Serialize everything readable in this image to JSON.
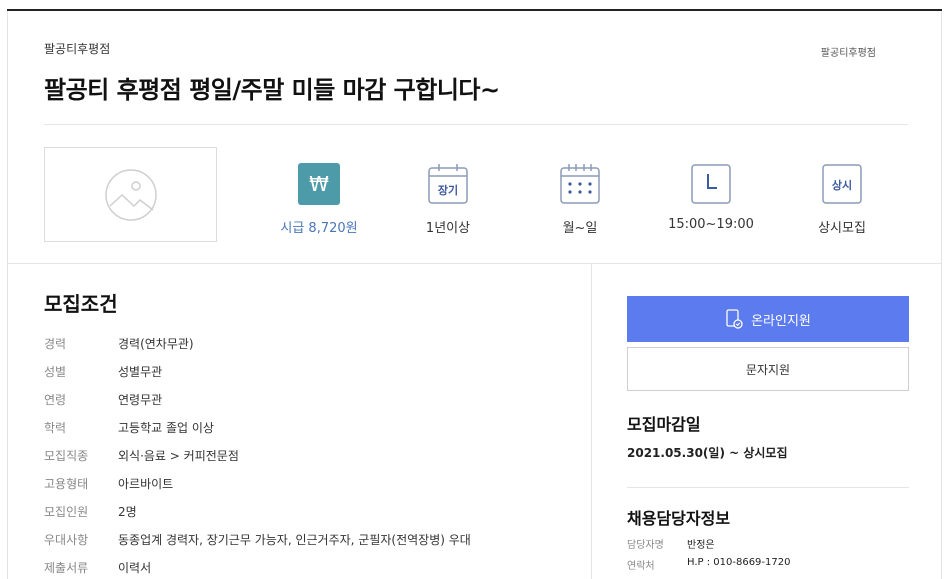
{
  "header": {
    "company": "팔공티후평점",
    "company_right": "팔공티후평점",
    "title": "팔공티 후평점 평일/주말 미들 마감 구합니다~"
  },
  "summary": [
    {
      "label": "시급 8,720원",
      "icon": "won-icon",
      "badge": "₩"
    },
    {
      "label": "1년이상",
      "icon": "calendar-long-term-icon",
      "badge": "장기"
    },
    {
      "label": "월~일",
      "icon": "calendar-days-icon"
    },
    {
      "label": "15:00~19:00",
      "icon": "clock-icon"
    },
    {
      "label": "상시모집",
      "icon": "always-recruit-icon",
      "badge": "상시"
    }
  ],
  "conditions": {
    "title": "모집조건",
    "rows": [
      {
        "key": "경력",
        "value": "경력(연차무관)"
      },
      {
        "key": "성별",
        "value": "성별무관"
      },
      {
        "key": "연령",
        "value": "연령무관"
      },
      {
        "key": "학력",
        "value": "고등학교 졸업 이상"
      },
      {
        "key": "모집직종",
        "value": "외식·음료 > 커피전문점"
      },
      {
        "key": "고용형태",
        "value": "아르바이트"
      },
      {
        "key": "모집인원",
        "value": "2명"
      },
      {
        "key": "우대사항",
        "value": "동종업계 경력자, 장기근무 가능자, 인근거주자, 군필자(전역장병) 우대"
      },
      {
        "key": "제출서류",
        "value": "이력서"
      }
    ]
  },
  "side": {
    "apply_online": "온라인지원",
    "apply_sms": "문자지원",
    "deadline_title": "모집마감일",
    "deadline_value": "2021.05.30(일) ~ 상시모집",
    "contact_title": "채용담당자정보",
    "contact_rows": [
      {
        "key": "담당자명",
        "value": "반정은"
      },
      {
        "key": "연락처",
        "value": "H.P : 010-8669-1720"
      }
    ]
  },
  "colors": {
    "accent_blue": "#5b7bef",
    "won_teal": "#4d9aa8",
    "label_blue": "#4a77b9"
  }
}
